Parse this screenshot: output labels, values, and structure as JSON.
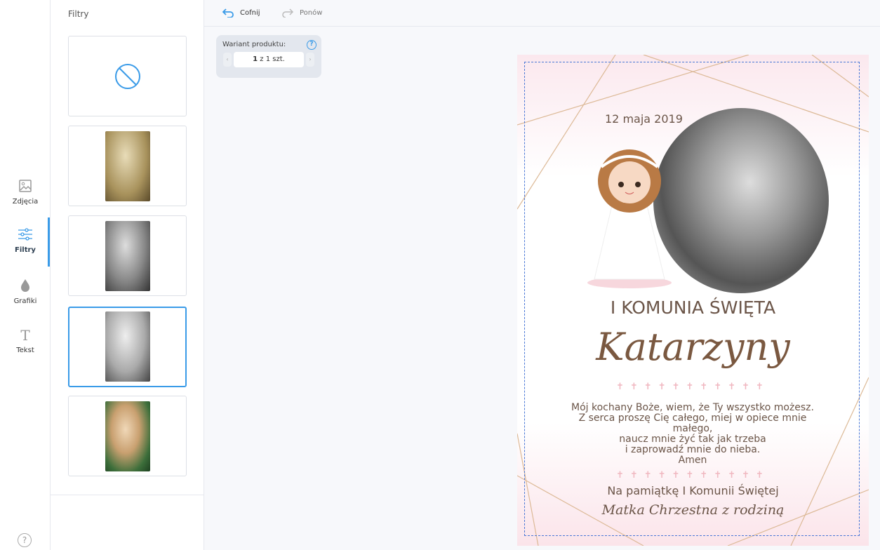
{
  "rail": {
    "items": [
      {
        "label": "Zdjęcia",
        "icon": "image-icon"
      },
      {
        "label": "Filtry",
        "icon": "sliders-icon",
        "active": true
      },
      {
        "label": "Grafiki",
        "icon": "drop-icon"
      },
      {
        "label": "Tekst",
        "icon": "text-icon"
      }
    ],
    "help": "?"
  },
  "panel": {
    "title": "Filtry",
    "filters": [
      "none",
      "sepia",
      "grayscale",
      "high-contrast-bw",
      "original"
    ],
    "selected": 3
  },
  "toolbar": {
    "undo": "Cofnij",
    "redo": "Ponów"
  },
  "variant": {
    "label": "Wariant produktu:",
    "current": "1",
    "rest": " z 1 szt.",
    "help": "?"
  },
  "card": {
    "date": "12 maja 2019",
    "heading": "I KOMUNIA ŚWIĘTA",
    "name": "Katarzyny",
    "crosses": "✝✝✝✝✝✝✝✝✝✝✝",
    "poem": [
      "Mój kochany Boże, wiem, że Ty wszystko możesz.",
      "Z serca proszę Cię całego, miej w opiece mnie małego,",
      "naucz mnie żyć tak jak trzeba",
      "i zaprowadź mnie do nieba.",
      "Amen"
    ],
    "footer1": "Na pamiątkę I Komunii Świętej",
    "footer2": "Matka Chrzestna z rodziną"
  },
  "colors": {
    "accent": "#3a9be8"
  }
}
